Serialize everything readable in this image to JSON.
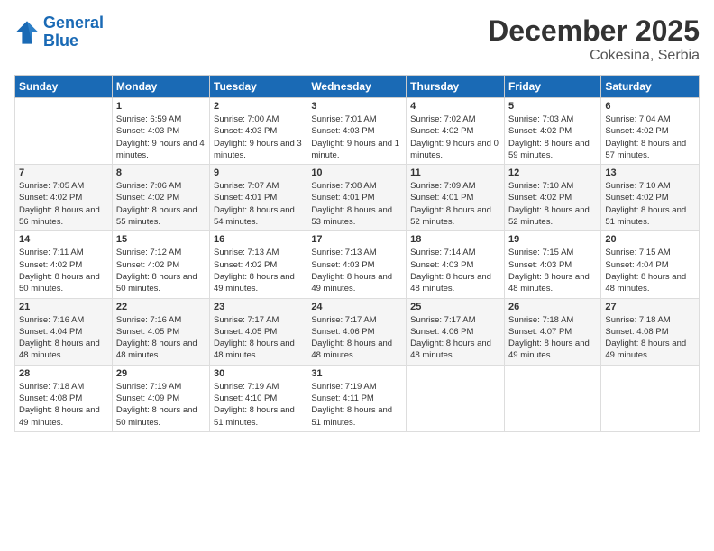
{
  "logo": {
    "line1": "General",
    "line2": "Blue"
  },
  "title": "December 2025",
  "subtitle": "Cokesina, Serbia",
  "days_header": [
    "Sunday",
    "Monday",
    "Tuesday",
    "Wednesday",
    "Thursday",
    "Friday",
    "Saturday"
  ],
  "weeks": [
    [
      {
        "day": "",
        "sunrise": "",
        "sunset": "",
        "daylight": ""
      },
      {
        "day": "1",
        "sunrise": "Sunrise: 6:59 AM",
        "sunset": "Sunset: 4:03 PM",
        "daylight": "Daylight: 9 hours and 4 minutes."
      },
      {
        "day": "2",
        "sunrise": "Sunrise: 7:00 AM",
        "sunset": "Sunset: 4:03 PM",
        "daylight": "Daylight: 9 hours and 3 minutes."
      },
      {
        "day": "3",
        "sunrise": "Sunrise: 7:01 AM",
        "sunset": "Sunset: 4:03 PM",
        "daylight": "Daylight: 9 hours and 1 minute."
      },
      {
        "day": "4",
        "sunrise": "Sunrise: 7:02 AM",
        "sunset": "Sunset: 4:02 PM",
        "daylight": "Daylight: 9 hours and 0 minutes."
      },
      {
        "day": "5",
        "sunrise": "Sunrise: 7:03 AM",
        "sunset": "Sunset: 4:02 PM",
        "daylight": "Daylight: 8 hours and 59 minutes."
      },
      {
        "day": "6",
        "sunrise": "Sunrise: 7:04 AM",
        "sunset": "Sunset: 4:02 PM",
        "daylight": "Daylight: 8 hours and 57 minutes."
      }
    ],
    [
      {
        "day": "7",
        "sunrise": "Sunrise: 7:05 AM",
        "sunset": "Sunset: 4:02 PM",
        "daylight": "Daylight: 8 hours and 56 minutes."
      },
      {
        "day": "8",
        "sunrise": "Sunrise: 7:06 AM",
        "sunset": "Sunset: 4:02 PM",
        "daylight": "Daylight: 8 hours and 55 minutes."
      },
      {
        "day": "9",
        "sunrise": "Sunrise: 7:07 AM",
        "sunset": "Sunset: 4:01 PM",
        "daylight": "Daylight: 8 hours and 54 minutes."
      },
      {
        "day": "10",
        "sunrise": "Sunrise: 7:08 AM",
        "sunset": "Sunset: 4:01 PM",
        "daylight": "Daylight: 8 hours and 53 minutes."
      },
      {
        "day": "11",
        "sunrise": "Sunrise: 7:09 AM",
        "sunset": "Sunset: 4:01 PM",
        "daylight": "Daylight: 8 hours and 52 minutes."
      },
      {
        "day": "12",
        "sunrise": "Sunrise: 7:10 AM",
        "sunset": "Sunset: 4:02 PM",
        "daylight": "Daylight: 8 hours and 52 minutes."
      },
      {
        "day": "13",
        "sunrise": "Sunrise: 7:10 AM",
        "sunset": "Sunset: 4:02 PM",
        "daylight": "Daylight: 8 hours and 51 minutes."
      }
    ],
    [
      {
        "day": "14",
        "sunrise": "Sunrise: 7:11 AM",
        "sunset": "Sunset: 4:02 PM",
        "daylight": "Daylight: 8 hours and 50 minutes."
      },
      {
        "day": "15",
        "sunrise": "Sunrise: 7:12 AM",
        "sunset": "Sunset: 4:02 PM",
        "daylight": "Daylight: 8 hours and 50 minutes."
      },
      {
        "day": "16",
        "sunrise": "Sunrise: 7:13 AM",
        "sunset": "Sunset: 4:02 PM",
        "daylight": "Daylight: 8 hours and 49 minutes."
      },
      {
        "day": "17",
        "sunrise": "Sunrise: 7:13 AM",
        "sunset": "Sunset: 4:03 PM",
        "daylight": "Daylight: 8 hours and 49 minutes."
      },
      {
        "day": "18",
        "sunrise": "Sunrise: 7:14 AM",
        "sunset": "Sunset: 4:03 PM",
        "daylight": "Daylight: 8 hours and 48 minutes."
      },
      {
        "day": "19",
        "sunrise": "Sunrise: 7:15 AM",
        "sunset": "Sunset: 4:03 PM",
        "daylight": "Daylight: 8 hours and 48 minutes."
      },
      {
        "day": "20",
        "sunrise": "Sunrise: 7:15 AM",
        "sunset": "Sunset: 4:04 PM",
        "daylight": "Daylight: 8 hours and 48 minutes."
      }
    ],
    [
      {
        "day": "21",
        "sunrise": "Sunrise: 7:16 AM",
        "sunset": "Sunset: 4:04 PM",
        "daylight": "Daylight: 8 hours and 48 minutes."
      },
      {
        "day": "22",
        "sunrise": "Sunrise: 7:16 AM",
        "sunset": "Sunset: 4:05 PM",
        "daylight": "Daylight: 8 hours and 48 minutes."
      },
      {
        "day": "23",
        "sunrise": "Sunrise: 7:17 AM",
        "sunset": "Sunset: 4:05 PM",
        "daylight": "Daylight: 8 hours and 48 minutes."
      },
      {
        "day": "24",
        "sunrise": "Sunrise: 7:17 AM",
        "sunset": "Sunset: 4:06 PM",
        "daylight": "Daylight: 8 hours and 48 minutes."
      },
      {
        "day": "25",
        "sunrise": "Sunrise: 7:17 AM",
        "sunset": "Sunset: 4:06 PM",
        "daylight": "Daylight: 8 hours and 48 minutes."
      },
      {
        "day": "26",
        "sunrise": "Sunrise: 7:18 AM",
        "sunset": "Sunset: 4:07 PM",
        "daylight": "Daylight: 8 hours and 49 minutes."
      },
      {
        "day": "27",
        "sunrise": "Sunrise: 7:18 AM",
        "sunset": "Sunset: 4:08 PM",
        "daylight": "Daylight: 8 hours and 49 minutes."
      }
    ],
    [
      {
        "day": "28",
        "sunrise": "Sunrise: 7:18 AM",
        "sunset": "Sunset: 4:08 PM",
        "daylight": "Daylight: 8 hours and 49 minutes."
      },
      {
        "day": "29",
        "sunrise": "Sunrise: 7:19 AM",
        "sunset": "Sunset: 4:09 PM",
        "daylight": "Daylight: 8 hours and 50 minutes."
      },
      {
        "day": "30",
        "sunrise": "Sunrise: 7:19 AM",
        "sunset": "Sunset: 4:10 PM",
        "daylight": "Daylight: 8 hours and 51 minutes."
      },
      {
        "day": "31",
        "sunrise": "Sunrise: 7:19 AM",
        "sunset": "Sunset: 4:11 PM",
        "daylight": "Daylight: 8 hours and 51 minutes."
      },
      {
        "day": "",
        "sunrise": "",
        "sunset": "",
        "daylight": ""
      },
      {
        "day": "",
        "sunrise": "",
        "sunset": "",
        "daylight": ""
      },
      {
        "day": "",
        "sunrise": "",
        "sunset": "",
        "daylight": ""
      }
    ]
  ]
}
